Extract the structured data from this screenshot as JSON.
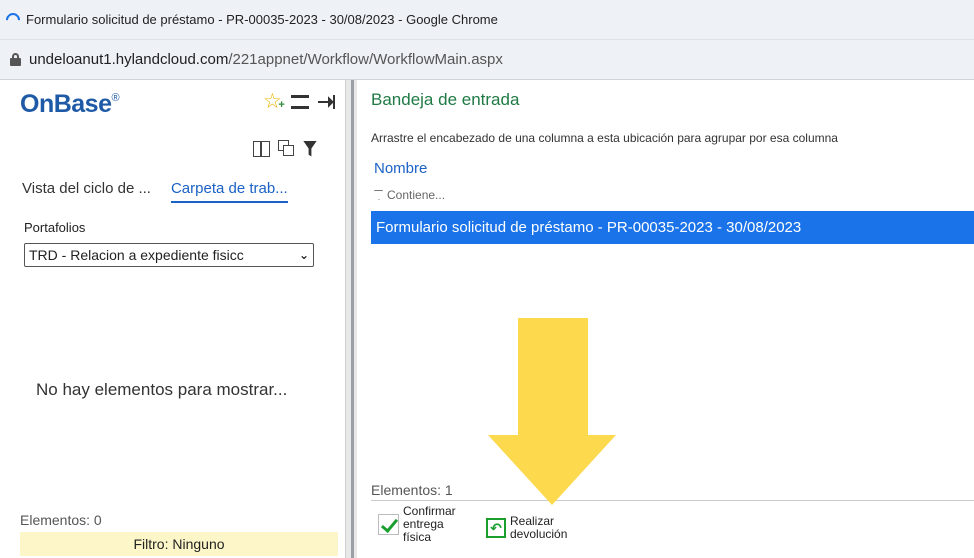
{
  "window": {
    "title": "Formulario solicitud de préstamo - PR-00035-2023 - 30/08/2023 - Google Chrome"
  },
  "address": {
    "host": "undeloanut1.hylandcloud.com",
    "path": "/221appnet/Workflow/WorkflowMain.aspx"
  },
  "left": {
    "logo": "OnBase",
    "logo_mark": "®",
    "icons": [
      "add-favorite-icon",
      "list-view-icon",
      "pin-icon",
      "columns-icon",
      "copy-icon",
      "filter-icon"
    ],
    "tabs": [
      {
        "label": "Vista del ciclo de ...",
        "active": false
      },
      {
        "label": "Carpeta de trab...",
        "active": true
      }
    ],
    "portafolios_label": "Portafolios",
    "portafolios_value": "TRD - Relacion a expediente fisicc",
    "empty_message": "No hay elementos para mostrar...",
    "count": "Elementos: 0",
    "filter": "Filtro: Ninguno"
  },
  "right": {
    "title": "Bandeja de entrada",
    "group_hint": "Arrastre el encabezado de una columna a esta ubicación para agrupar por esa columna",
    "column_header": "Nombre",
    "filter_placeholder": "Contiene...",
    "rows": [
      {
        "name": "Formulario solicitud de préstamo - PR-00035-2023 - 30/08/2023",
        "selected": true
      }
    ],
    "count": "Elementos: 1",
    "actions": {
      "confirm": {
        "line1": "Confirmar",
        "line2": "entrega",
        "line3": "física"
      },
      "refund": {
        "line1": "Realizar",
        "line2": "devolución"
      }
    }
  },
  "colors": {
    "accent_blue": "#1a73e8",
    "title_green": "#1f7a45",
    "filter_yellow": "#fcf6c9",
    "arrow_yellow": "#fdd94e"
  }
}
